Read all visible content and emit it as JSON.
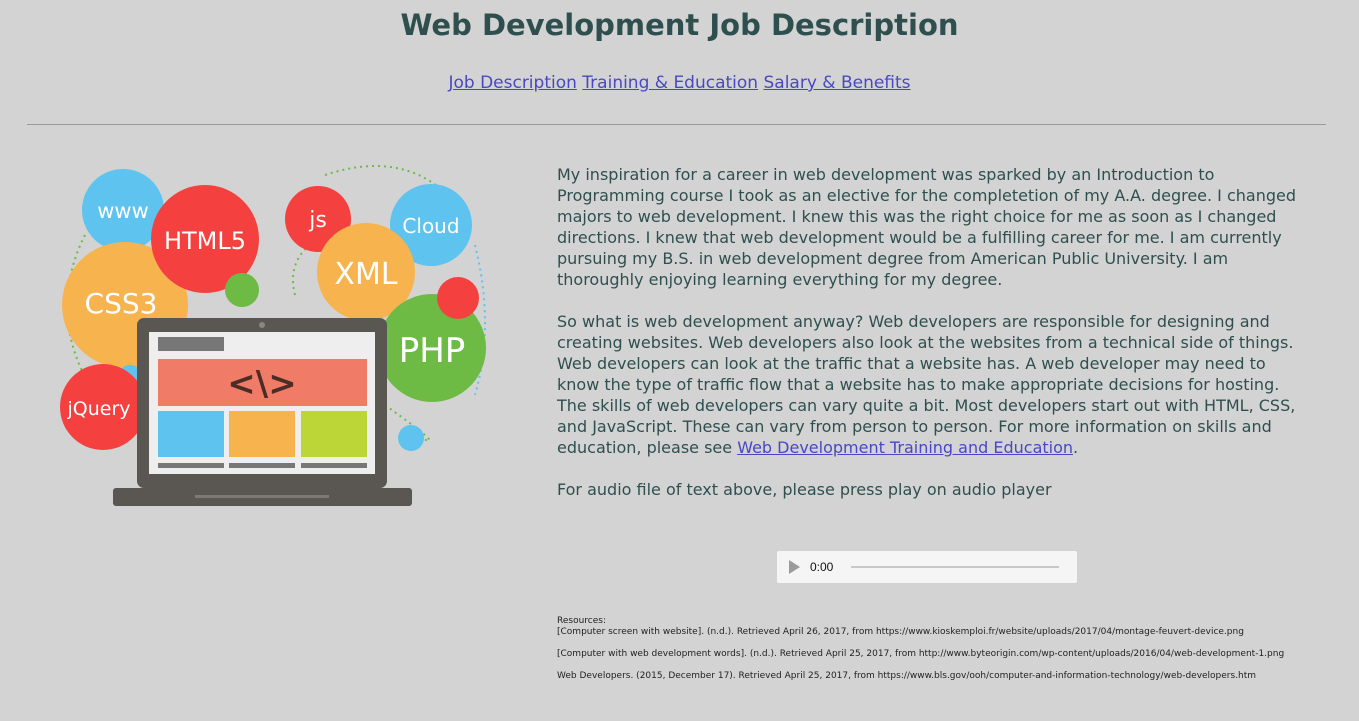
{
  "page": {
    "title": "Web Development Job Description"
  },
  "nav": {
    "items": [
      "Job Description",
      "Training & Education",
      "Salary & Benefits"
    ]
  },
  "illustration": {
    "labels": {
      "www": "www",
      "html5": "HTML5",
      "js": "js",
      "cloud": "Cloud",
      "css3": "CSS3",
      "xml": "XML",
      "php": "PHP",
      "jquery": "jQuery",
      "code": "<\\>"
    },
    "colors": {
      "blue": "#5ec3ef",
      "red": "#f4413f",
      "orange": "#f6b34e",
      "green": "#6dbb45",
      "banner": "#f07b66",
      "lime": "#bdd637",
      "laptop": "#5a5652"
    }
  },
  "content": {
    "p1": "My inspiration for a career in web development was sparked by an Introduction to Programming course I took as an elective for the completetion of my A.A. degree. I changed majors to web development. I knew this was the right choice for me as soon as I changed directions. I knew that web development would be a fulfilling career for me. I am currently pursuing my B.S. in web development degree from American Public University. I am thoroughly enjoying learning everything for my degree.",
    "p2": "So what is web development anyway? Web developers are responsible for designing and creating websites. Web developers also look at the websites from a technical side of things. Web developers can look at the traffic that a website has. A web developer may need to know the type of traffic flow that a website has to make appropriate decisions for hosting.",
    "p3_lead": "The skills of web developers can vary quite a bit. Most developers start out with HTML, CSS, and JavaScript. These can vary from person to person. For more information on skills and education, please see ",
    "p3_link": "Web Development Training and Education",
    "p3_tail": ".",
    "p4": "For audio file of text above, please press play on audio player"
  },
  "audio": {
    "time": "0:00"
  },
  "resources": {
    "heading": "Resources:",
    "items": [
      "[Computer screen with website]. (n.d.). Retrieved April 26, 2017, from https://www.kioskemploi.fr/website/uploads/2017/04/montage-feuvert-device.png",
      "[Computer with web development words]. (n.d.). Retrieved April 25, 2017, from http://www.byteorigin.com/wp-content/uploads/2016/04/web-development-1.png",
      "Web Developers. (2015, December 17). Retrieved April 25, 2017, from https://www.bls.gov/ooh/computer-and-information-technology/web-developers.htm"
    ]
  }
}
